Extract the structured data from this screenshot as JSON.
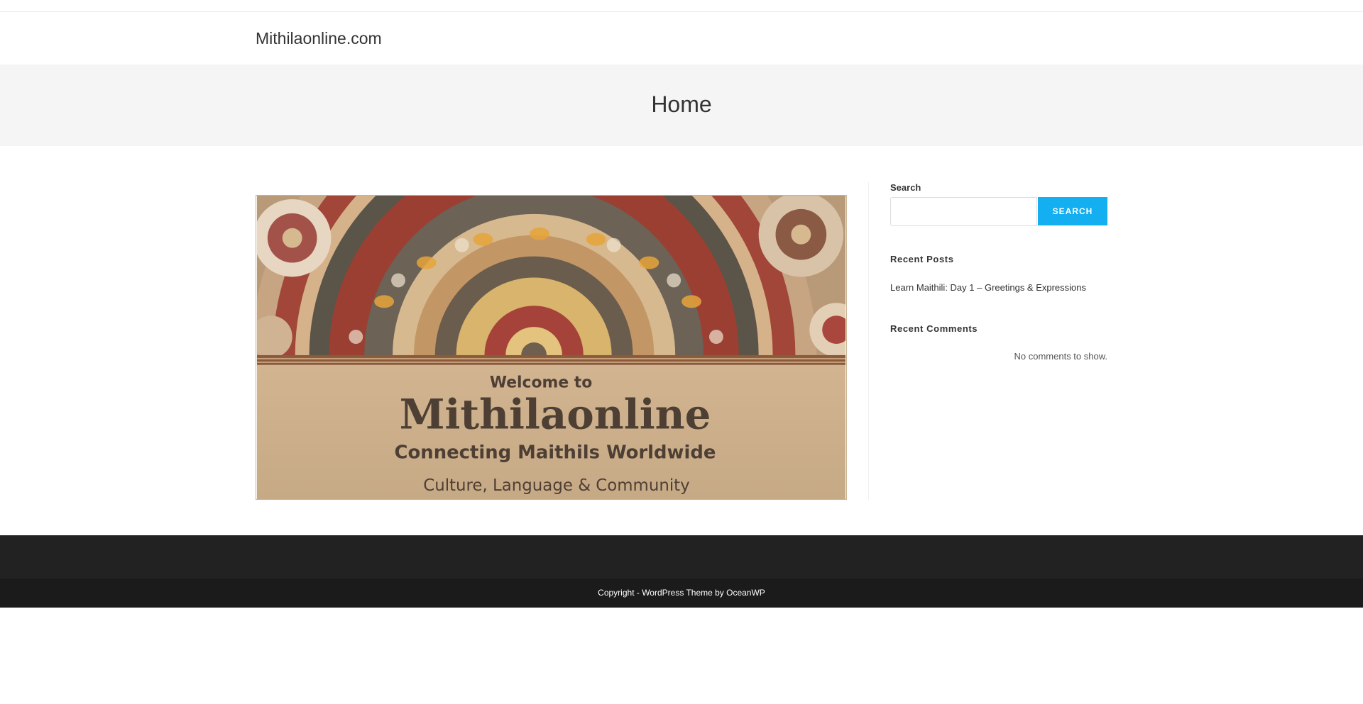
{
  "site": {
    "title": "Mithilaonline.com"
  },
  "page": {
    "title": "Home"
  },
  "hero": {
    "image_text": {
      "line1": "Welcome to",
      "line2": "Mithilaonline",
      "line3": "Connecting Maithils Worldwide",
      "line4": "Culture, Language & Community"
    }
  },
  "sidebar": {
    "search": {
      "label": "Search",
      "value": "",
      "button_label": "SEARCH"
    },
    "recent_posts": {
      "title": "Recent Posts",
      "items": [
        {
          "label": "Learn Maithili: Day 1 – Greetings & Expressions"
        }
      ]
    },
    "recent_comments": {
      "title": "Recent Comments",
      "empty_text": "No comments to show."
    }
  },
  "footer": {
    "copyright": "Copyright - WordPress Theme by OceanWP"
  },
  "colors": {
    "accent": "#13aff0",
    "footer_bg": "#222222",
    "page_header_bg": "#f5f5f5"
  }
}
